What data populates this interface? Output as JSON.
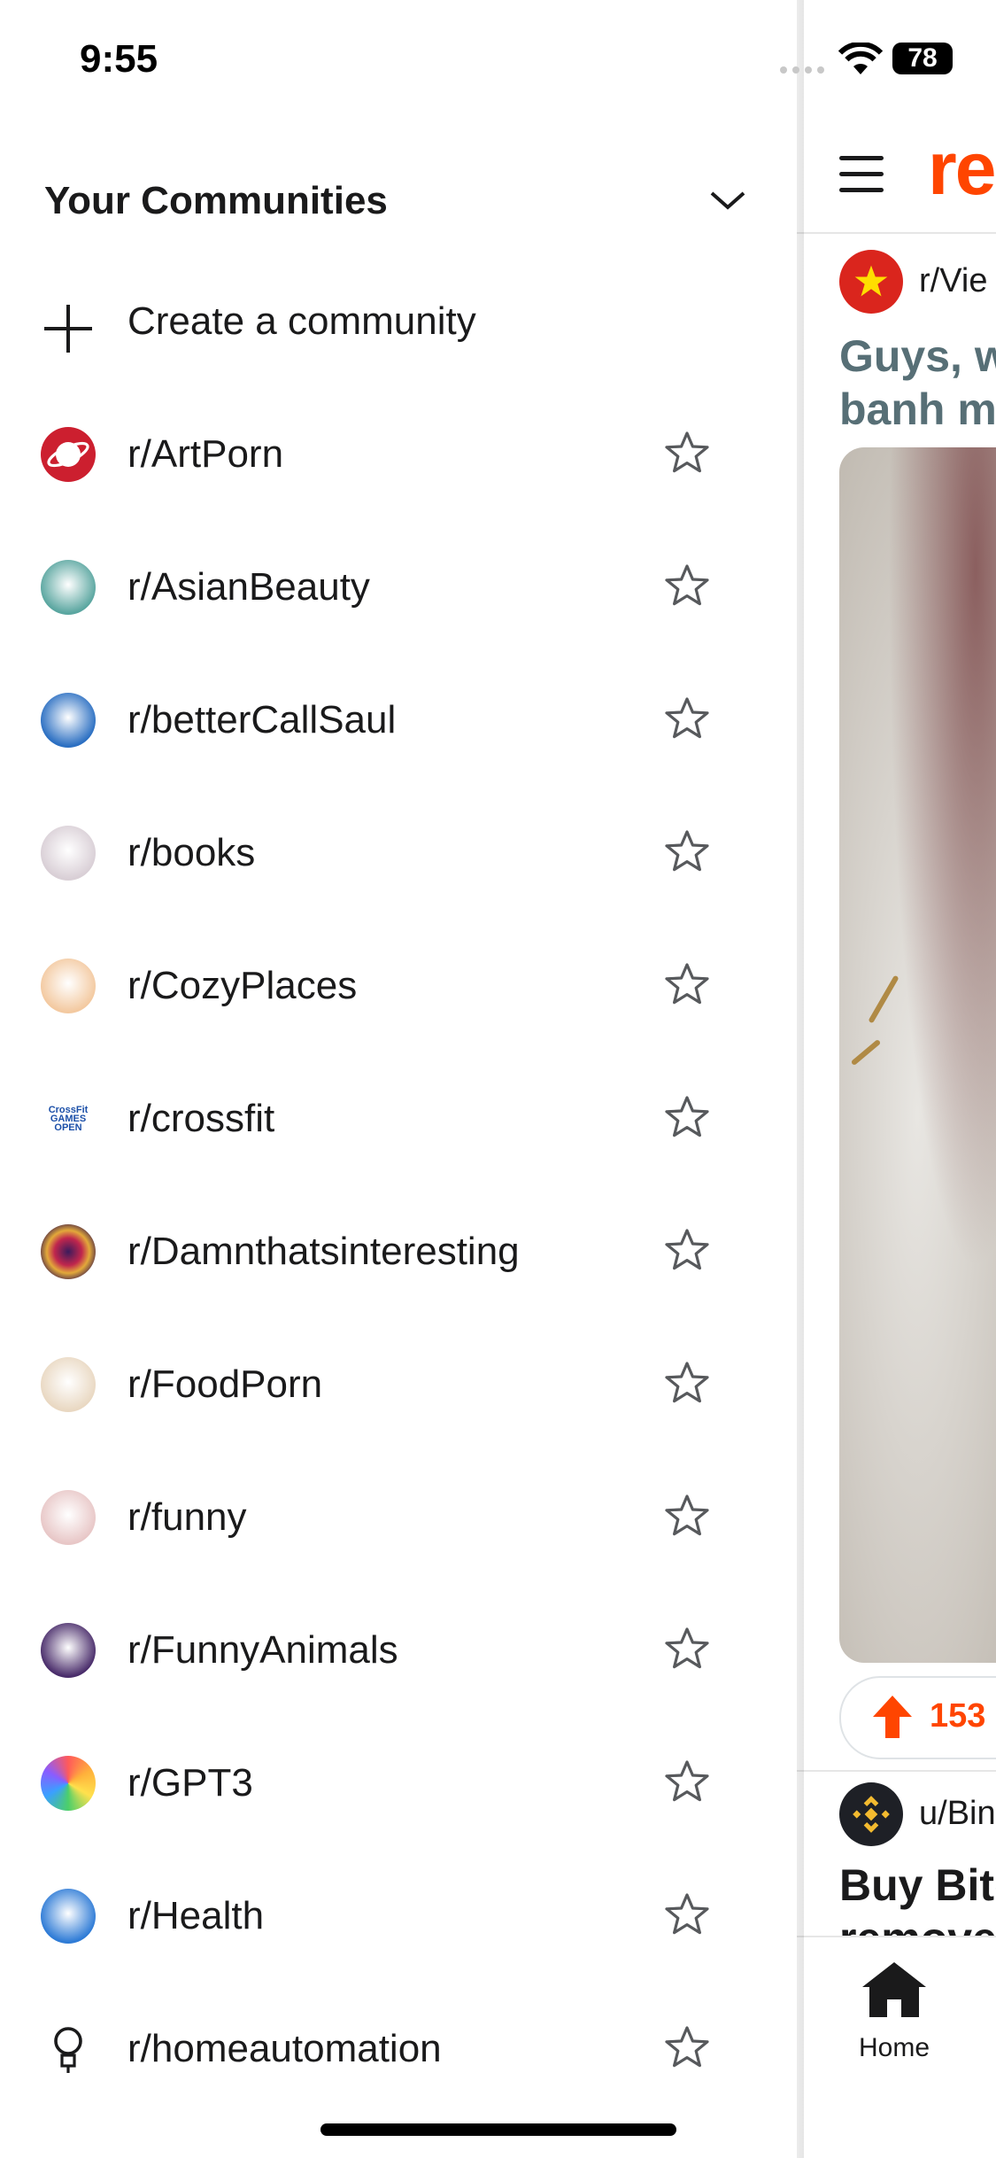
{
  "status_bar": {
    "time": "9:55",
    "battery": "78"
  },
  "drawer": {
    "section_title": "Your Communities",
    "create_label": "Create a community",
    "communities": [
      {
        "name": "r/ArtPorn",
        "icon": "saturn-icon",
        "color": "#cc1f2f"
      },
      {
        "name": "r/AsianBeauty",
        "icon": "bee-icon",
        "color": "#5aa6a0"
      },
      {
        "name": "r/betterCallSaul",
        "icon": "saul-portrait-icon",
        "color": "#2b6fc2"
      },
      {
        "name": "r/books",
        "icon": "book-icon",
        "color": "#d9cfd6"
      },
      {
        "name": "r/CozyPlaces",
        "icon": "cozy-room-icon",
        "color": "#f3c9a0"
      },
      {
        "name": "r/crossfit",
        "icon": "crossfit-games-icon",
        "color": "#ffffff"
      },
      {
        "name": "r/Damnthatsinteresting",
        "icon": "swirl-icon",
        "color": "#7a1f4f"
      },
      {
        "name": "r/FoodPorn",
        "icon": "souffle-icon",
        "color": "#e9d8c2"
      },
      {
        "name": "r/funny",
        "icon": "snoo-funny-icon",
        "color": "#e8c7c7"
      },
      {
        "name": "r/FunnyAnimals",
        "icon": "cat-icon",
        "color": "#4a2d6b"
      },
      {
        "name": "r/GPT3",
        "icon": "openai-icon",
        "color": "#ff5a5a"
      },
      {
        "name": "r/Health",
        "icon": "snoo-health-icon",
        "color": "#2e7bd6"
      },
      {
        "name": "r/homeautomation",
        "icon": "lightbulb-icon",
        "color": "#ffffff"
      }
    ]
  },
  "feed": {
    "logo": "re",
    "post": {
      "subreddit": "r/Vie",
      "title_line1": "Guys, w",
      "title_line2": "banh m",
      "votes": "153"
    },
    "ad": {
      "user": "u/Bin",
      "title_line1": "Buy Bitc",
      "title_line2": "remove"
    },
    "tab_home": "Home"
  },
  "colors": {
    "accent": "#ff4500",
    "text": "#1a1a1b",
    "muted": "#576f76"
  }
}
